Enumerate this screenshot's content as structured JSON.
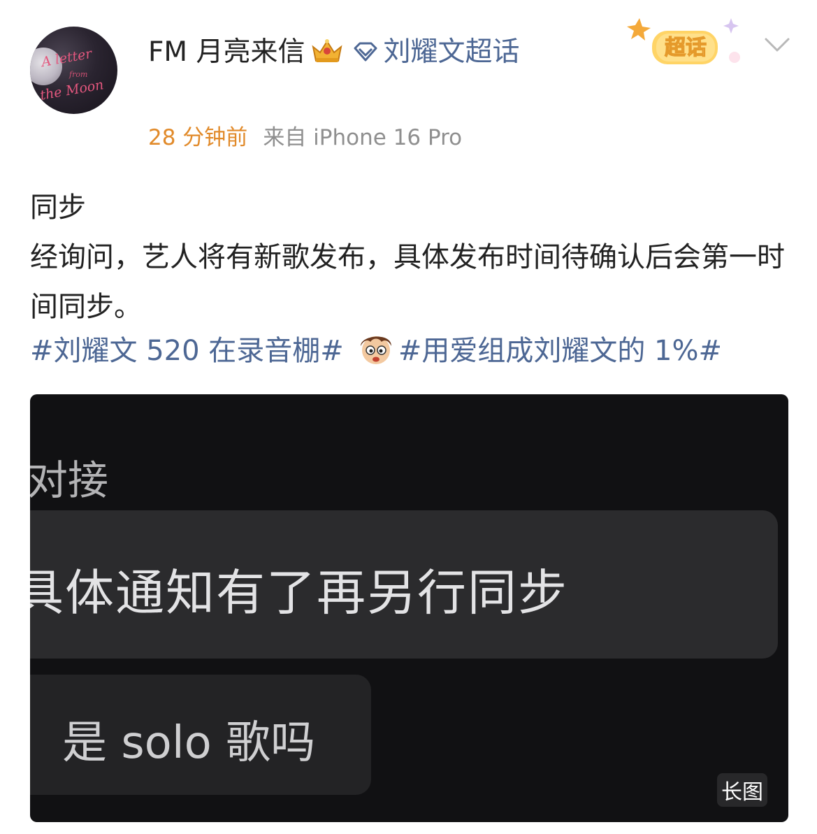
{
  "header": {
    "username": "FM 月亮来信",
    "supertopic": "刘耀文超话",
    "avatar_text": [
      "A letter",
      "from",
      "the Moon"
    ],
    "time": "28 分钟前",
    "source": "来自 iPhone 16 Pro",
    "badge_label": "超话",
    "icons": [
      "crown-icon",
      "diamond-icon",
      "supertopic-badge-icon",
      "chevron-down-icon"
    ]
  },
  "content": {
    "lines": [
      "同步",
      "经询问，艺人将有新歌发布，具体发布时间待确认后会第一时间同步。"
    ]
  },
  "hashtags": [
    "#刘耀文 520 在录音棚#",
    "#用爱组成刘耀文的 1%#"
  ],
  "image": {
    "top_text": "对接",
    "bubble1_text": "具体通知有了再另行同步",
    "bubble2_text": "是 solo 歌吗",
    "long_image_label": "长图"
  },
  "colors": {
    "link": "#4d6794",
    "time": "#e18a2a",
    "meta": "#8f8f8f",
    "text": "#222222",
    "image_bg": "#111113"
  }
}
